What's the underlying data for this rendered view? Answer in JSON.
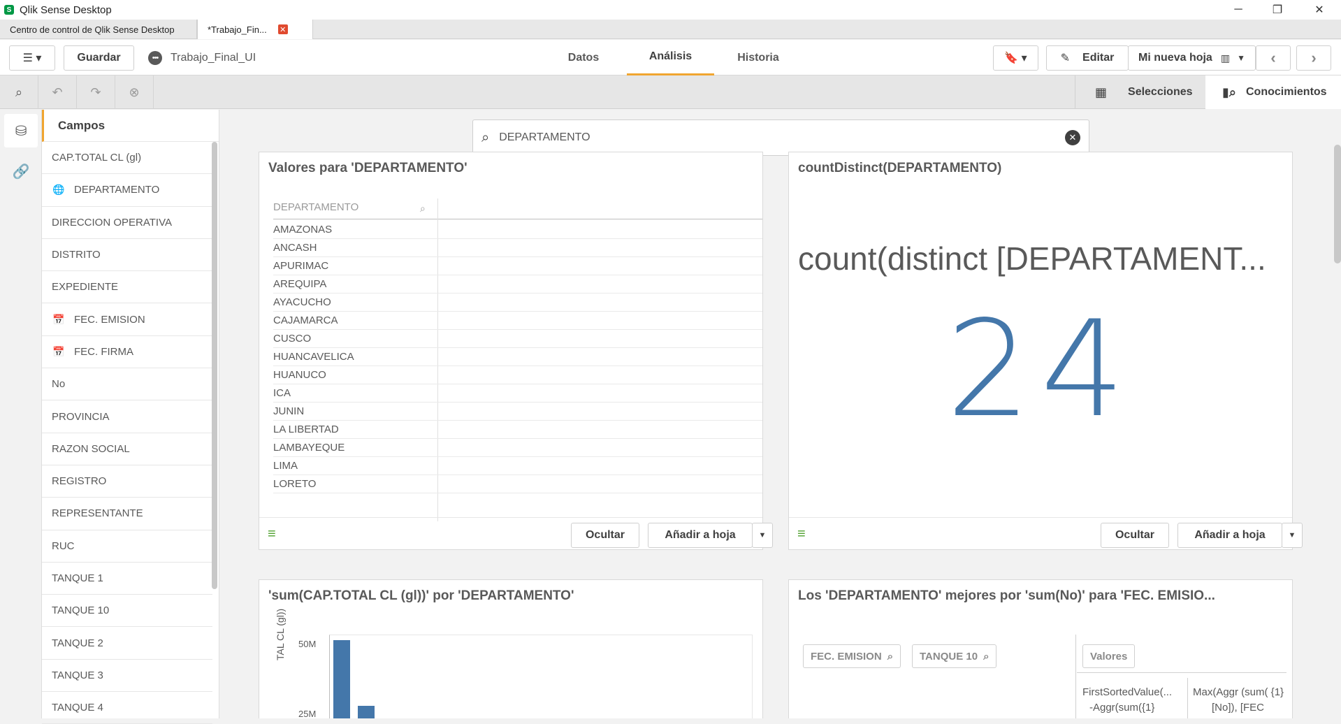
{
  "window": {
    "title": "Qlik Sense Desktop",
    "app_icon": "S",
    "controls": [
      "─",
      "❐",
      "✕"
    ]
  },
  "doc_tabs": [
    {
      "label": "Centro de control de Qlik Sense Desktop"
    },
    {
      "label": "*Trabajo_Fin...",
      "close": "✕"
    }
  ],
  "toolbar": {
    "save_label": "Guardar",
    "app_name": "Trabajo_Final_UI",
    "tabs": [
      {
        "label": "Datos"
      },
      {
        "label": "Análisis"
      },
      {
        "label": "Historia"
      }
    ],
    "edit_label": "Editar",
    "sheet_label": "Mi nueva hoja"
  },
  "selbar": {
    "selections_label": "Selecciones",
    "insights_label": "Conocimientos"
  },
  "fields_panel": {
    "header": "Campos",
    "items": [
      {
        "label": "CAP.TOTAL CL (gl)",
        "icon": ""
      },
      {
        "label": "DEPARTAMENTO",
        "icon": "globe-icon"
      },
      {
        "label": "DIRECCION OPERATIVA",
        "icon": ""
      },
      {
        "label": "DISTRITO",
        "icon": ""
      },
      {
        "label": "EXPEDIENTE",
        "icon": ""
      },
      {
        "label": "FEC. EMISION",
        "icon": "calendar-icon"
      },
      {
        "label": "FEC. FIRMA",
        "icon": "calendar-icon"
      },
      {
        "label": "No",
        "icon": ""
      },
      {
        "label": "PROVINCIA",
        "icon": ""
      },
      {
        "label": "RAZON SOCIAL",
        "icon": ""
      },
      {
        "label": "REGISTRO",
        "icon": ""
      },
      {
        "label": "REPRESENTANTE",
        "icon": ""
      },
      {
        "label": "RUC",
        "icon": ""
      },
      {
        "label": "TANQUE 1",
        "icon": ""
      },
      {
        "label": "TANQUE 10",
        "icon": ""
      },
      {
        "label": "TANQUE 2",
        "icon": ""
      },
      {
        "label": "TANQUE 3",
        "icon": ""
      },
      {
        "label": "TANQUE 4",
        "icon": ""
      }
    ]
  },
  "search": {
    "value": "DEPARTAMENTO"
  },
  "card_values": {
    "title": "Valores para 'DEPARTAMENTO'",
    "column": "DEPARTAMENTO",
    "rows": [
      "AMAZONAS",
      "ANCASH",
      "APURIMAC",
      "AREQUIPA",
      "AYACUCHO",
      "CAJAMARCA",
      "CUSCO",
      "HUANCAVELICA",
      "HUANUCO",
      "ICA",
      "JUNIN",
      "LA LIBERTAD",
      "LAMBAYEQUE",
      "LIMA",
      "LORETO"
    ],
    "hide_label": "Ocultar",
    "add_label": "Añadir a hoja"
  },
  "card_kpi": {
    "title": "countDistinct(DEPARTAMENTO)",
    "measure": "count(distinct [DEPARTAMENT...",
    "value": "24",
    "hide_label": "Ocultar",
    "add_label": "Añadir a hoja"
  },
  "card_bar": {
    "title": "'sum(CAP.TOTAL CL (gl))' por 'DEPARTAMENTO'",
    "ylabel": "TAL CL (gl))",
    "tick_top": "50M",
    "tick_next": "25M",
    "color": "#4477aa"
  },
  "card_table": {
    "title": "Los 'DEPARTAMENTO' mejores por 'sum(No)' para 'FEC. EMISIO...",
    "chips": [
      "FEC. EMISION",
      "TANQUE 10"
    ],
    "values_chip": "Valores",
    "col1": "FirstSortedValue(...",
    "col1b": "-Aggr(sum({1}",
    "col2": "Max(Aggr (sum( {1}",
    "col2b": "[No]), [FEC"
  },
  "colors": {
    "accent": "#f0a530",
    "kpi": "#4477aa",
    "close_tab": "#e04a2f"
  }
}
